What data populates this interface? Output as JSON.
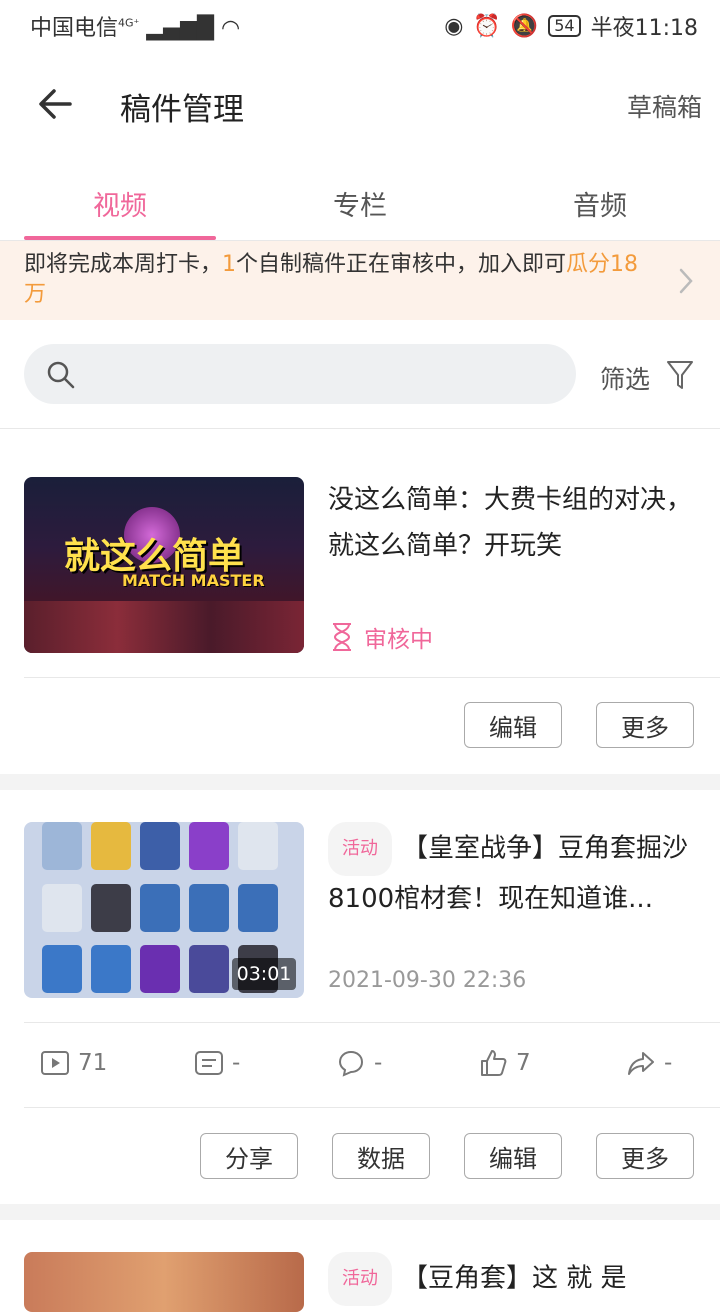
{
  "status_bar": {
    "carrier": "中国电信",
    "network": "4G⁺",
    "battery": "54",
    "time": "半夜11:18"
  },
  "header": {
    "title": "稿件管理",
    "drafts_label": "草稿箱"
  },
  "tabs": [
    {
      "label": "视频",
      "active": true
    },
    {
      "label": "专栏",
      "active": false
    },
    {
      "label": "音频",
      "active": false
    }
  ],
  "banner": {
    "text_a": "即将完成本周打卡，",
    "count": "1",
    "text_b": "个自制稿件正在审核中，加入即可",
    "reward": "瓜分18万"
  },
  "search": {
    "placeholder": "",
    "filter_label": "筛选"
  },
  "videos": [
    {
      "title": "没这么简单：大费卡组的对决，就这么简单？开玩笑",
      "thumb_caption": "就这么简单",
      "thumb_sub": "MATCH MASTER",
      "status": "审核中",
      "buttons": [
        "编辑",
        "更多"
      ]
    },
    {
      "badge": "活动",
      "title": "【皇室战争】豆角套掘沙8100棺材套！现在知道谁...",
      "duration": "03:01",
      "date": "2021-09-30 22:36",
      "stats": {
        "plays": "71",
        "danmaku": "-",
        "comments": "-",
        "likes": "7",
        "shares": "-"
      },
      "buttons": [
        "分享",
        "数据",
        "编辑",
        "更多"
      ]
    },
    {
      "badge": "活动",
      "title": "【豆角套】这 就 是"
    }
  ],
  "colors": {
    "accent": "#f0679a",
    "highlight": "#f39b3c",
    "banner_bg": "#fdf2ea"
  }
}
